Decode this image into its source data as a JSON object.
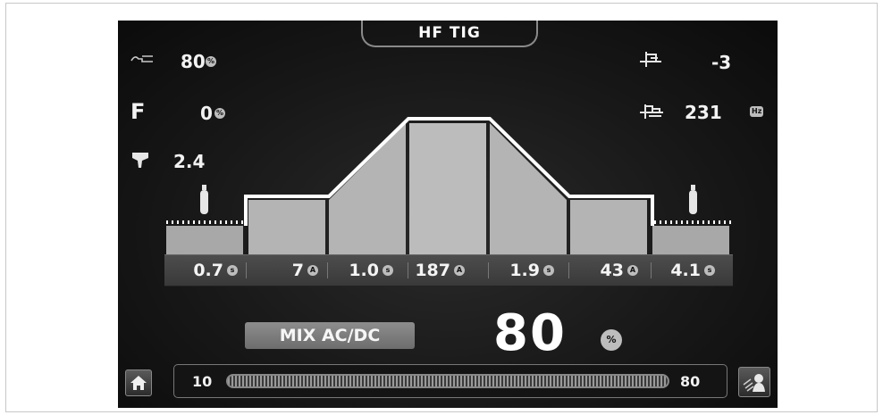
{
  "header": {
    "title": "HF TIG"
  },
  "left_params": [
    {
      "icon": "ac-balance-icon",
      "value": "80",
      "unit": "%"
    },
    {
      "label": "F",
      "value": "0",
      "unit": "%"
    },
    {
      "icon": "electrode-icon",
      "value": "2.4"
    }
  ],
  "right_params": [
    {
      "icon": "offset-icon",
      "value": "-3"
    },
    {
      "icon": "frequency-icon",
      "value": "231",
      "unit": "Hz"
    }
  ],
  "sequence": [
    {
      "value": "0.7",
      "unit": "s"
    },
    {
      "value": "7",
      "unit": "A"
    },
    {
      "value": "1.0",
      "unit": "s"
    },
    {
      "value": "187",
      "unit": "A"
    },
    {
      "value": "1.9",
      "unit": "s"
    },
    {
      "value": "43",
      "unit": "A"
    },
    {
      "value": "4.1",
      "unit": "s"
    }
  ],
  "mode": {
    "label": "MIX AC/DC"
  },
  "main_value": {
    "value": "80",
    "unit": "%"
  },
  "slider": {
    "min": "10",
    "max": "80",
    "level": 1.0
  },
  "colors": {
    "screen": "#181818",
    "text": "#f2f2f2",
    "graph_fill": "#b8b8b8",
    "graph_line": "#ffffff"
  },
  "icons": {
    "home": "home-icon",
    "weld": "welding-torch-icon",
    "gas": "gas-cylinder-icon"
  }
}
